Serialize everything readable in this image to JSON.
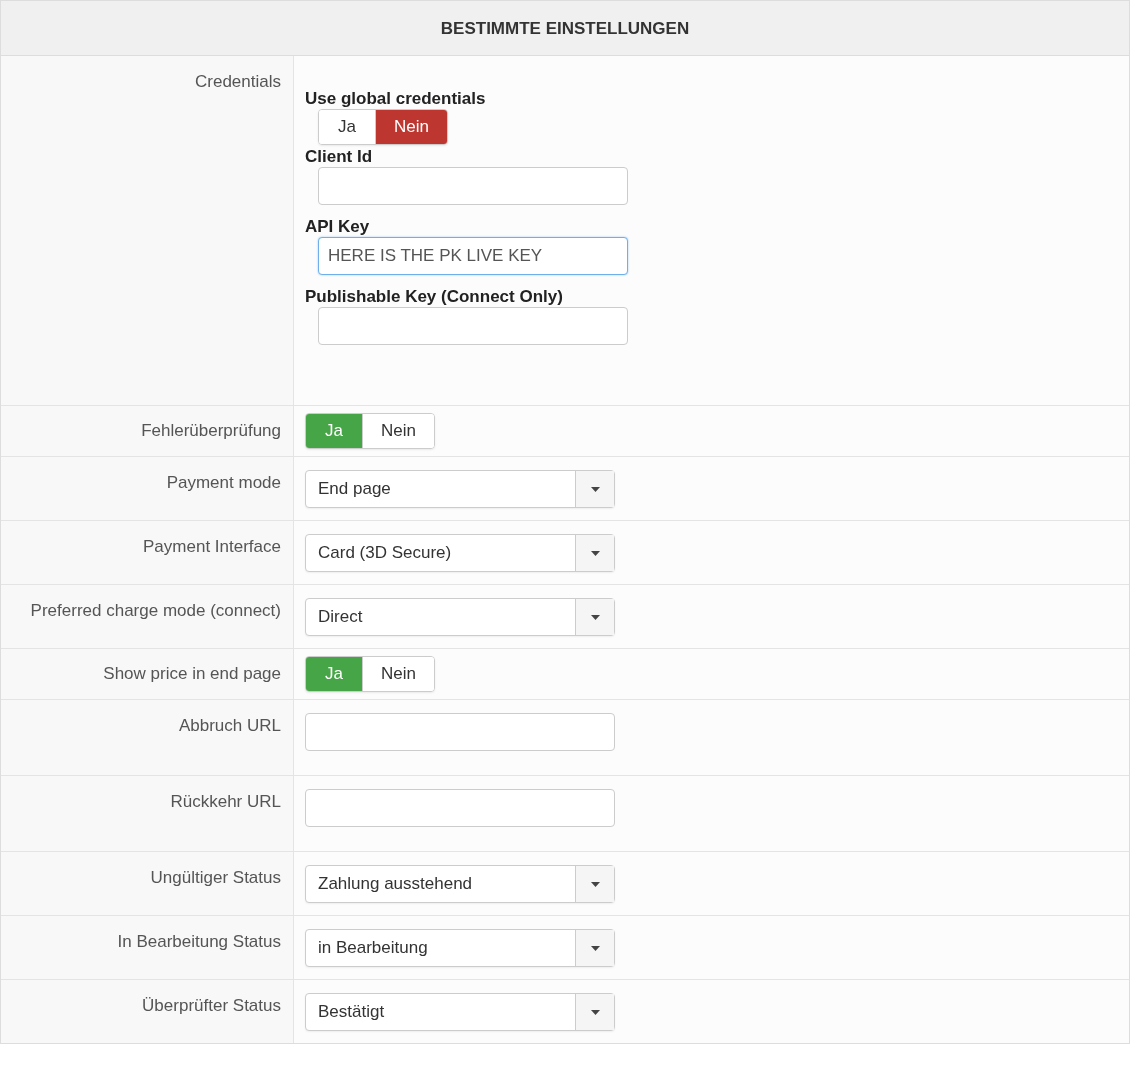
{
  "header": {
    "title": "BESTIMMTE EINSTELLUNGEN"
  },
  "rows": [
    {
      "label": "Credentials",
      "kind": "group",
      "fields": [
        {
          "label": "Use global credentials",
          "kind": "toggle",
          "options": [
            {
              "label": "Ja",
              "selected": false
            },
            {
              "label": "Nein",
              "selected": true
            }
          ]
        },
        {
          "label": "Client Id",
          "kind": "text"
        },
        {
          "label": "API Key",
          "kind": "text",
          "value": "HERE IS THE PK LIVE KEY",
          "focused": true
        },
        {
          "label": "Publishable Key (Connect Only)",
          "kind": "text"
        }
      ]
    },
    {
      "label": "Fehlerüberprüfung",
      "kind": "toggle",
      "options": [
        {
          "label": "Ja",
          "selected": true
        },
        {
          "label": "Nein",
          "selected": false
        }
      ]
    },
    {
      "label": "Payment mode",
      "kind": "select",
      "value": "End page"
    },
    {
      "label": "Payment Interface",
      "kind": "select",
      "value": "Card (3D Secure)"
    },
    {
      "label": "Preferred charge mode (connect)",
      "kind": "select",
      "value": "Direct"
    },
    {
      "label": "Show price in end page",
      "kind": "toggle",
      "options": [
        {
          "label": "Ja",
          "selected": true
        },
        {
          "label": "Nein",
          "selected": false
        }
      ]
    },
    {
      "label": "Abbruch URL",
      "kind": "text"
    },
    {
      "label": "Rückkehr URL",
      "kind": "text"
    },
    {
      "label": "Ungültiger Status",
      "kind": "select",
      "value": "Zahlung ausstehend"
    },
    {
      "label": "In Bearbeitung Status",
      "kind": "select",
      "value": "in Bearbeitung"
    },
    {
      "label": "Überprüfter Status",
      "kind": "select",
      "value": "Bestätigt"
    }
  ]
}
